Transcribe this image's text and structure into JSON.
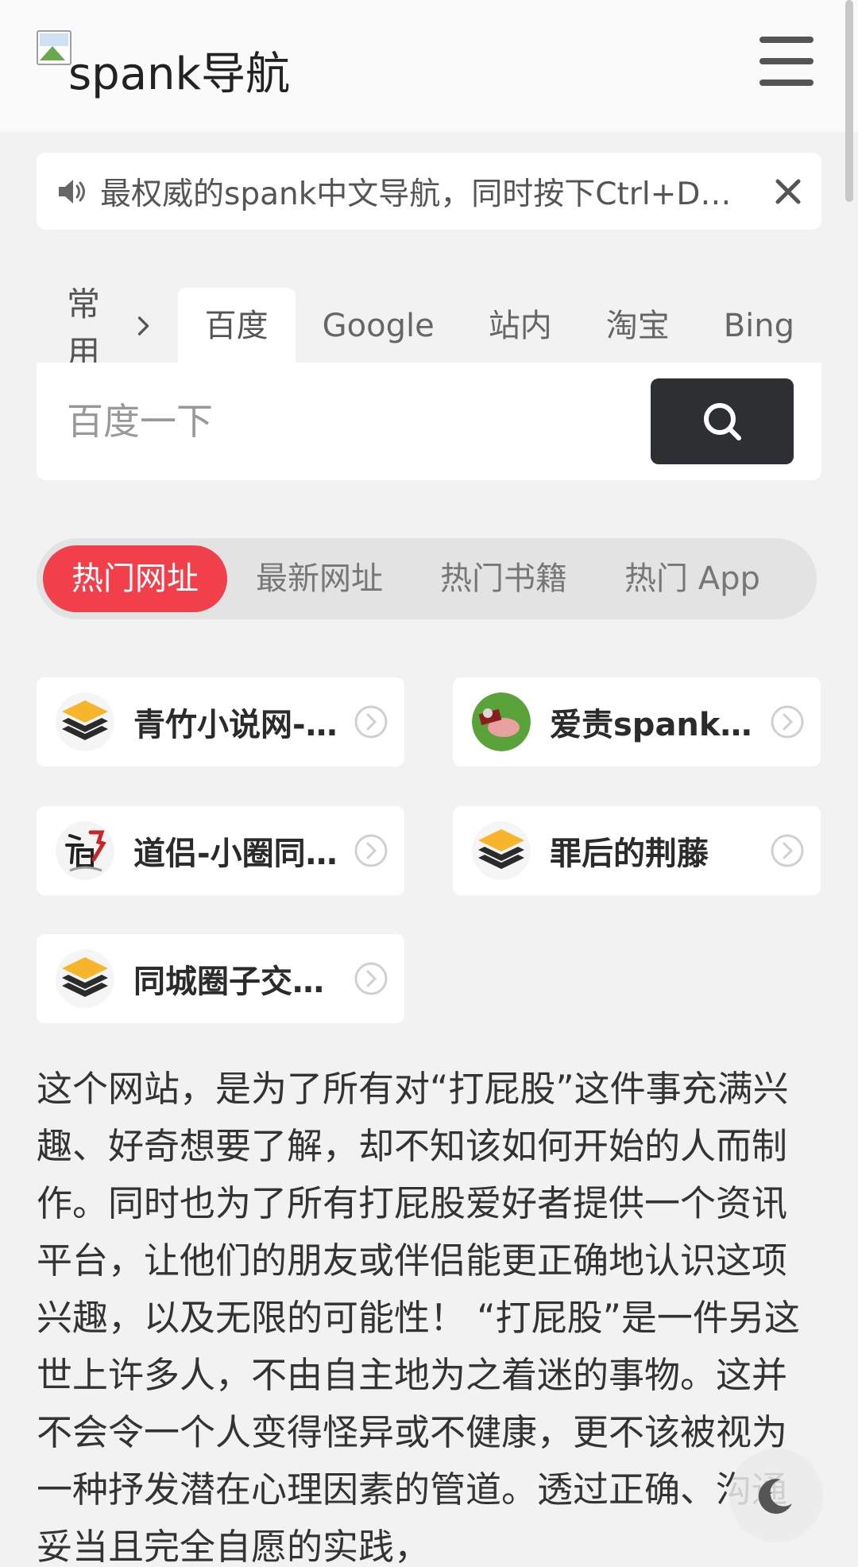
{
  "header": {
    "logo_text": "spank导航"
  },
  "notice": {
    "text": "最权威的spank中文导航，同时按下Ctrl+D收藏本站"
  },
  "search": {
    "category_label": "常用",
    "engines": [
      "百度",
      "Google",
      "站内",
      "淘宝",
      "Bing"
    ],
    "active_engine": "百度",
    "placeholder": "百度一下"
  },
  "tabs": {
    "items": [
      "热门网址",
      "最新网址",
      "热门书籍",
      "热门 App"
    ],
    "active": "热门网址",
    "accent_color": "#f1404b"
  },
  "sites": [
    {
      "name": "青竹小说网-spank小说",
      "icon": "layers-icon"
    },
    {
      "name": "爱责spank文化",
      "icon": "site-avatar-icon"
    },
    {
      "name": "道侣-小圈同城交友",
      "icon": "dao-logo-icon"
    },
    {
      "name": "罪后的荆藤",
      "icon": "layers-icon"
    },
    {
      "name": "同城圈子交友平台",
      "icon": "layers-icon"
    }
  ],
  "description": "这个网站，是为了所有对“打屁股”这件事充满兴趣、好奇想要了解，却不知该如何开始的人而制作。同时也为了所有打屁股爱好者提供一个资讯平台，让他们的朋友或伴侣能更正确地认识这项兴趣，以及无限的可能性！ “打屁股”是一件另这世上许多人，不由自主地为之着迷的事物。这并不会令一个人变得怪异或不健康，更不该被视为一种抒发潜在心理因素的管道。透过正确、沟通妥当且完全自愿的实践，"
}
